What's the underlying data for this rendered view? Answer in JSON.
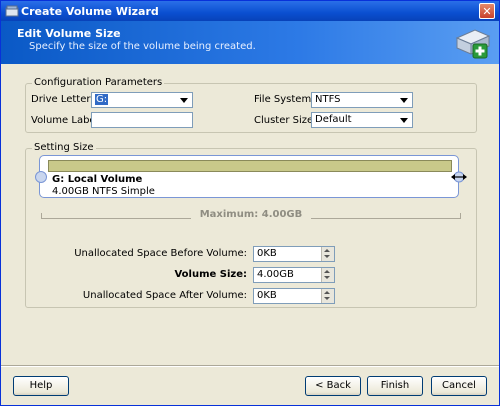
{
  "window": {
    "title": "Create Volume Wizard",
    "close_glyph": "✕"
  },
  "header": {
    "title": "Edit Volume Size",
    "subtitle": "Specify the size of the volume being created."
  },
  "config": {
    "legend": "Configuration Parameters",
    "drive_letter_label": "Drive Letter:",
    "drive_letter_value": "G:",
    "volume_label_label": "Volume Label:",
    "volume_label_value": "",
    "file_system_label": "File System:",
    "file_system_value": "NTFS",
    "cluster_size_label": "Cluster Size:",
    "cluster_size_value": "Default"
  },
  "setting_size": {
    "legend": "Setting Size",
    "volume_name": "G: Local Volume",
    "volume_desc": "4.00GB NTFS Simple",
    "bar_fill_fraction": 1.0,
    "maximum_label": "Maximum: 4.00GB",
    "unalloc_before_label": "Unallocated Space Before Volume:",
    "unalloc_before_value": "0KB",
    "volume_size_label": "Volume Size:",
    "volume_size_value": "4.00GB",
    "unalloc_after_label": "Unallocated Space After Volume:",
    "unalloc_after_value": "0KB"
  },
  "buttons": {
    "help": "Help",
    "back": "< Back",
    "finish": "Finish",
    "cancel": "Cancel"
  },
  "icons": {
    "app": "wizard-app-icon",
    "header": "add-volume-icon",
    "resize": "resize-horizontal-icon"
  },
  "colors": {
    "titlebar": "#0a4fd0",
    "header": "#2d7ae6",
    "volume_bar": "#c9c98a"
  }
}
